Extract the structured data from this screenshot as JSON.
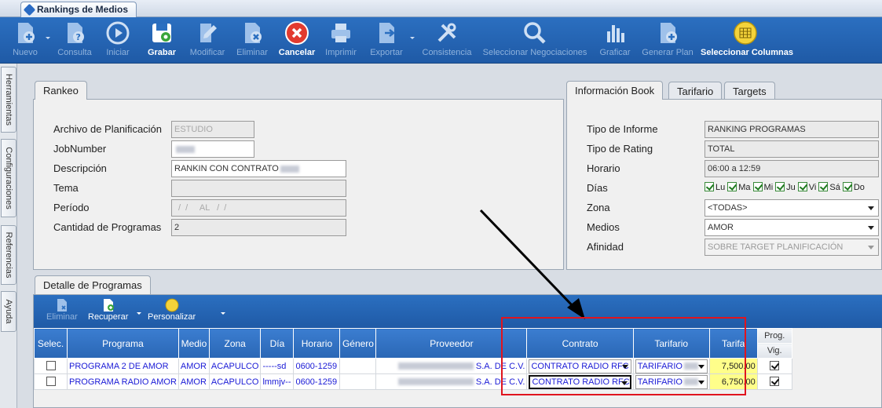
{
  "window": {
    "tab_title": "Rankings de Medios"
  },
  "toolbar": {
    "buttons": [
      {
        "label": "Nuevo",
        "state": "disabled"
      },
      {
        "label": "Consulta",
        "state": "disabled"
      },
      {
        "label": "Iniciar",
        "state": "disabled"
      },
      {
        "label": "Grabar",
        "state": "enabled"
      },
      {
        "label": "Modificar",
        "state": "disabled"
      },
      {
        "label": "Eliminar",
        "state": "disabled"
      },
      {
        "label": "Cancelar",
        "state": "enabled"
      },
      {
        "label": "Imprimir",
        "state": "disabled"
      },
      {
        "label": "Exportar",
        "state": "disabled"
      },
      {
        "label": "Consistencia",
        "state": "disabled"
      },
      {
        "label": "Seleccionar Negociaciones",
        "state": "disabled"
      },
      {
        "label": "Graficar",
        "state": "disabled"
      },
      {
        "label": "Generar Plan",
        "state": "disabled"
      },
      {
        "label": "Seleccionar Columnas",
        "state": "enabled"
      }
    ],
    "icons": [
      "new-doc-icon",
      "query-doc-icon",
      "play-icon",
      "save-disk-icon",
      "edit-pencil-icon",
      "delete-doc-icon",
      "cancel-x-icon",
      "printer-icon",
      "export-doc-icon",
      "tools-icon",
      "search-magnifier-icon",
      "bar-chart-icon",
      "generate-plan-icon",
      "columns-grid-icon"
    ]
  },
  "side_tabs": [
    "Herramientas",
    "Configuraciones",
    "Referencias",
    "Ayuda"
  ],
  "rankeo": {
    "tab": "Rankeo",
    "fields": {
      "archivo_label": "Archivo de Planificación",
      "archivo_value": "ESTUDIO",
      "jobnumber_label": "JobNumber",
      "descripcion_label": "Descripción",
      "descripcion_value": "RANKIN CON CONTRATO",
      "tema_label": "Tema",
      "periodo_label": "Período",
      "periodo_value": "/  /     AL   /  /",
      "cantidad_label": "Cantidad de Programas",
      "cantidad_value": "2"
    }
  },
  "info": {
    "tabs": [
      "Información Book",
      "Tarifario",
      "Targets"
    ],
    "tipo_informe_label": "Tipo de Informe",
    "tipo_informe_value": "RANKING PROGRAMAS",
    "tipo_rating_label": "Tipo de Rating",
    "tipo_rating_value": "TOTAL",
    "horario_label": "Horario",
    "horario_value": "06:00 a 12:59",
    "dias_label": "Días",
    "dias": [
      "Lu",
      "Ma",
      "Mi",
      "Ju",
      "Vi",
      "Sá",
      "Do"
    ],
    "zona_label": "Zona",
    "zona_value": "<TODAS>",
    "medios_label": "Medios",
    "medios_value": "AMOR",
    "afinidad_label": "Afinidad",
    "afinidad_value": "SOBRE TARGET PLANIFICACIÓN"
  },
  "detalle": {
    "tab": "Detalle de Programas",
    "toolbar": {
      "eliminar": "Eliminar",
      "recuperar": "Recuperar",
      "personalizar": "Personalizar"
    },
    "columns": {
      "selec": "Selec.",
      "programa": "Programa",
      "medio": "Medio",
      "zona": "Zona",
      "dia": "Día",
      "horario": "Horario",
      "genero": "Género",
      "proveedor": "Proveedor",
      "contrato": "Contrato",
      "tarifario": "Tarifario",
      "tarifa": "Tarifa",
      "prog": "Prog.",
      "vig": "Vig."
    },
    "rows": [
      {
        "programa": "PROGRAMA 2 DE AMOR",
        "medio": "AMOR",
        "zona": "ACAPULCO",
        "dia": "-----sd",
        "horario": "0600-1259",
        "genero": "",
        "proveedor": "S.A. DE C.V.",
        "contrato": "CONTRATO RADIO RFC",
        "tarifario": "TARIFARIO",
        "tarifa": "7,500.00",
        "prog_vig": true
      },
      {
        "programa": "PROGRAMA RADIO AMOR",
        "medio": "AMOR",
        "zona": "ACAPULCO",
        "dia": "lmmjv--",
        "horario": "0600-1259",
        "genero": "",
        "proveedor": "S.A. DE C.V.",
        "contrato": "CONTRATO RADIO RFC",
        "tarifario": "TARIFARIO",
        "tarifa": "6,750.00",
        "prog_vig": true
      }
    ]
  }
}
